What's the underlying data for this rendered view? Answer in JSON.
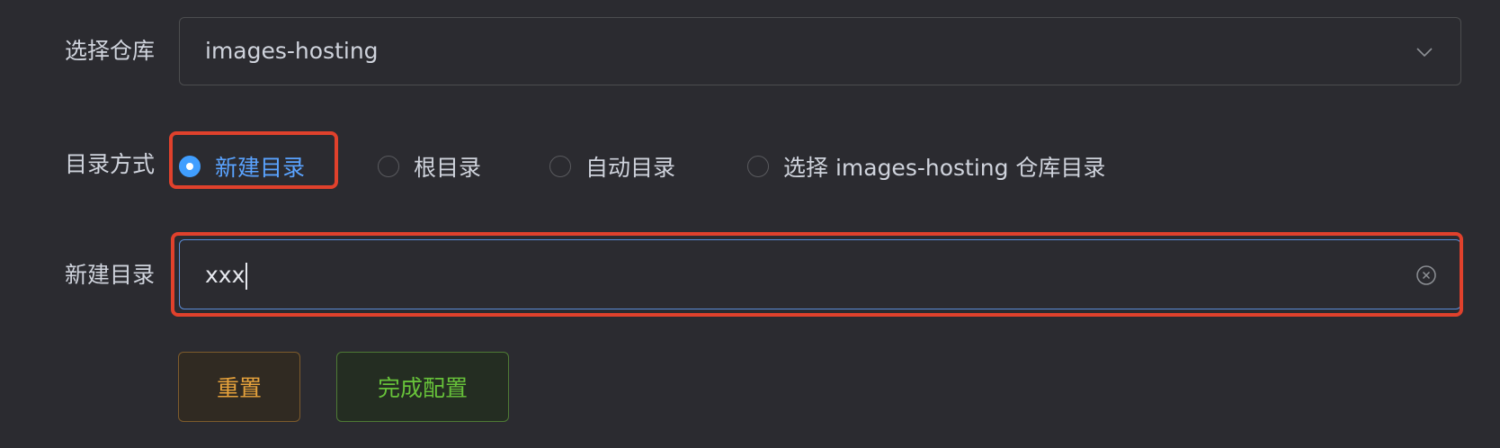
{
  "form": {
    "repo": {
      "label": "选择仓库",
      "selected_value": "images-hosting"
    },
    "dir_mode": {
      "label": "目录方式",
      "options": [
        {
          "label": "新建目录",
          "checked": true
        },
        {
          "label": "根目录",
          "checked": false
        },
        {
          "label": "自动目录",
          "checked": false
        },
        {
          "label": "选择 images-hosting 仓库目录",
          "checked": false
        }
      ]
    },
    "new_dir": {
      "label": "新建目录",
      "value": "xxx"
    },
    "buttons": {
      "reset": "重置",
      "finish": "完成配置"
    }
  },
  "colors": {
    "background": "#2b2b30",
    "primary": "#409eff",
    "warning": "#e6a23c",
    "success": "#67c23a",
    "highlight": "#e0412c"
  },
  "icons": {
    "select_arrow": "chevron-down-icon",
    "input_clear": "circle-close-icon"
  }
}
